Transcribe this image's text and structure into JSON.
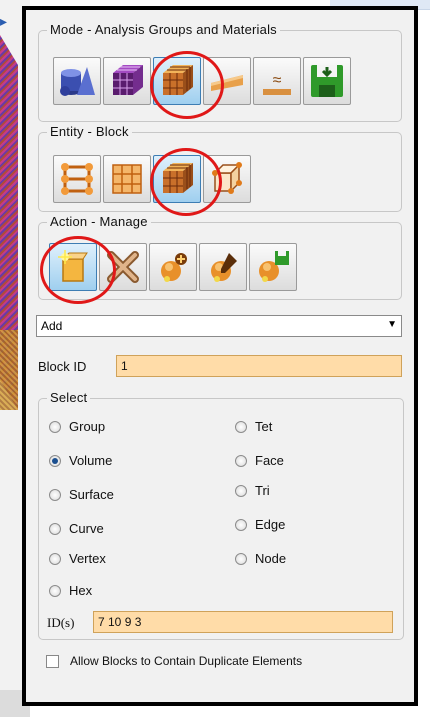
{
  "mode_group": {
    "title": "Mode - Analysis Groups and Materials",
    "buttons": [
      {
        "name": "geometry-mode-icon",
        "selected": false
      },
      {
        "name": "mesh-mode-icon",
        "selected": false
      },
      {
        "name": "analysis-groups-materials-icon",
        "selected": true
      },
      {
        "name": "boundary-conditions-icon",
        "selected": false
      },
      {
        "name": "solver-settings-icon",
        "selected": false
      },
      {
        "name": "export-save-icon",
        "selected": false
      }
    ]
  },
  "entity_group": {
    "title": "Entity - Block",
    "buttons": [
      {
        "name": "nodeset-icon",
        "selected": false
      },
      {
        "name": "sideset-icon",
        "selected": false
      },
      {
        "name": "block-icon",
        "selected": true
      },
      {
        "name": "group-icon",
        "selected": false
      }
    ]
  },
  "action_group": {
    "title": "Action - Manage",
    "buttons": [
      {
        "name": "manage-add-icon",
        "selected": true
      },
      {
        "name": "manage-delete-icon",
        "selected": false
      },
      {
        "name": "manage-add-element-icon",
        "selected": false
      },
      {
        "name": "manage-modify-icon",
        "selected": false
      },
      {
        "name": "manage-save-icon",
        "selected": false
      }
    ]
  },
  "operation": {
    "selected": "Add"
  },
  "block_id": {
    "label": "Block ID",
    "value": "1"
  },
  "select_group": {
    "title": "Select",
    "options_left": [
      {
        "label": "Group",
        "checked": false
      },
      {
        "label": "Volume",
        "checked": true
      },
      {
        "label": "Surface",
        "checked": false
      },
      {
        "label": "Curve",
        "checked": false
      },
      {
        "label": "Vertex",
        "checked": false
      },
      {
        "label": "Hex",
        "checked": false
      }
    ],
    "options_right": [
      {
        "label": "Tet",
        "checked": false
      },
      {
        "label": "Face",
        "checked": false
      },
      {
        "label": "Tri",
        "checked": false
      },
      {
        "label": "Edge",
        "checked": false
      },
      {
        "label": "Node",
        "checked": false
      }
    ],
    "ids_label": "ID(s)",
    "ids_value": "7 10 9 3"
  },
  "duplicates": {
    "label": "Allow Blocks to Contain Duplicate Elements",
    "checked": false
  },
  "colors": {
    "field_bg": "#ffdca8",
    "selected_button": "#9fcfef",
    "highlight_ring": "#e01818"
  }
}
